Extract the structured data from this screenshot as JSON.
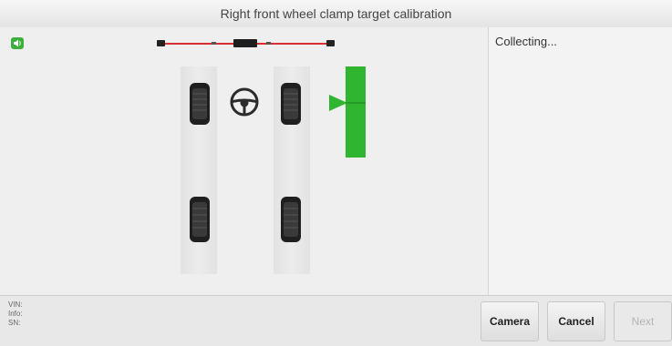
{
  "header": {
    "title": "Right front wheel clamp target calibration"
  },
  "status": {
    "text": "Collecting..."
  },
  "footer": {
    "vin_label": "VIN:",
    "info_label": "Info:",
    "sn_label": "SN:",
    "buttons": {
      "camera": "Camera",
      "cancel": "Cancel",
      "next": "Next"
    }
  },
  "colors": {
    "accent_green": "#2fb52f",
    "beam_red": "#d83030",
    "disabled_text": "#b4b4b4"
  },
  "icons": [
    "sound-icon",
    "steering-wheel-icon",
    "target-arrow-icon",
    "tire-icon"
  ]
}
